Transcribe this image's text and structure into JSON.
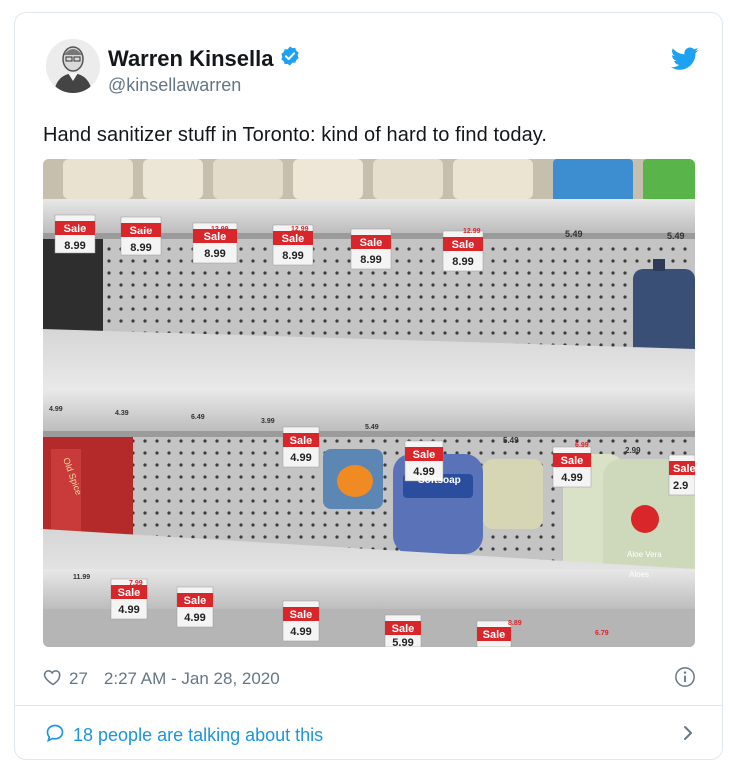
{
  "tweet": {
    "author_name": "Warren Kinsella",
    "author_handle": "@kinsellawarren",
    "text": "Hand sanitizer stuff in Toronto: kind of hard to find today.",
    "likes": "27",
    "timestamp": "2:27 AM - Jan 28, 2020",
    "talking": "18 people are talking about this"
  },
  "colors": {
    "brand": "#1da1f2",
    "link": "#1b95e0",
    "muted": "#657786",
    "sale": "#d8262b"
  },
  "icons": {
    "verified": "verified-badge-icon",
    "twitter": "twitter-bird-icon",
    "like": "heart-icon",
    "info": "info-icon",
    "talk": "speech-bubble-icon",
    "chevron": "chevron-right-icon"
  },
  "photo": {
    "shelf_labels": {
      "sale": "Sale",
      "top": [
        "8.99",
        "8.99",
        "8.99",
        "8.99",
        "8.99",
        "8.99"
      ],
      "top_small": [
        "12.99",
        "12.99",
        "12.99",
        "12.99",
        "12.99",
        "5.49",
        "5.49"
      ],
      "middle": [
        "4.99",
        "4.99",
        "4.99",
        "2.9"
      ],
      "middle_small": [
        "4.99",
        "4.39",
        "6.49",
        "3.99",
        "5.49",
        "5.49",
        "6.99",
        "2.99"
      ],
      "bottom": [
        "4.99",
        "4.99",
        "4.99",
        "5.99"
      ],
      "bottom_small": [
        "11.99",
        "7.99",
        "8.89",
        "6.79"
      ],
      "product_text": [
        "Softsoap",
        "Aloe Vera",
        "Aloes",
        "Old Spice"
      ]
    }
  }
}
